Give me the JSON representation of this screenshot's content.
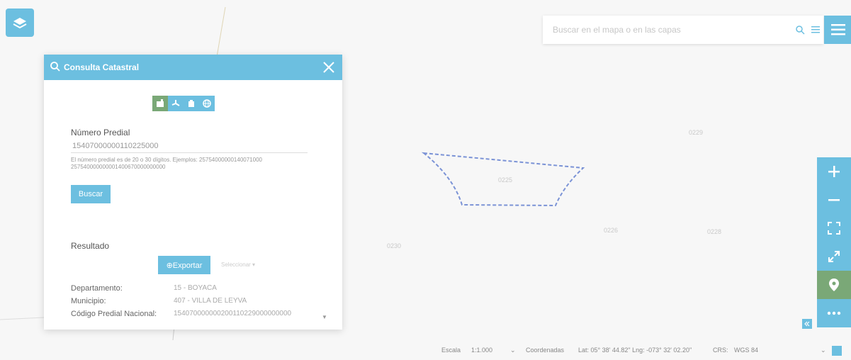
{
  "search": {
    "placeholder": "Buscar en el mapa o en las capas"
  },
  "panel": {
    "title": "Consulta Catastral",
    "field_label": "Número Predial",
    "predial_value": "15407000000110225000",
    "help_text": "El número predial es de 20 o 30 dígitos. Ejemplos: 25754000000140071000 257540000000001400670000000000",
    "search_button": "Buscar",
    "result_label": "Resultado",
    "export_button": "⊕Exportar",
    "export_select": "Seleccionar ▾",
    "results": [
      {
        "key": "Departamento:",
        "value": "15 - BOYACA"
      },
      {
        "key": "Municipio:",
        "value": "407 - VILLA DE LEYVA"
      },
      {
        "key": "Código Predial Nacional:",
        "value": "154070000000200110229000000000"
      }
    ]
  },
  "map_labels": [
    "0225",
    "0226",
    "0228",
    "0229",
    "0230"
  ],
  "status": {
    "scale_label": "Escala",
    "scale_value": "1:1.000",
    "coords_label": "Coordenadas",
    "latlng": "Lat: 05° 38' 44.82\" Lng: -073° 32' 02.20\"",
    "crs_label": "CRS:",
    "crs_value": "WGS 84"
  },
  "colors": {
    "accent": "#6cbfe0",
    "active": "#7aa877",
    "parcel": "#7b93d6"
  }
}
